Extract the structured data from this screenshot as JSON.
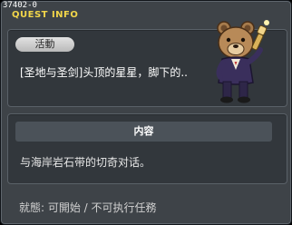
{
  "quest_id": "37402-0",
  "window_title": "QUEST INFO",
  "activity_badge": "活動",
  "quest_name": "[圣地与圣剑]头顶的星星，脚下的..",
  "content_header": "内容",
  "content_text": "与海岸岩石带的切奇对话。",
  "status_text": "就態: 可開始 / 不可执行任務",
  "npc_icon": "bear-npc-with-telescope",
  "colors": {
    "title": "#f2d64a",
    "window_bg": "#3e4348",
    "panel_bg": "#32373c"
  }
}
